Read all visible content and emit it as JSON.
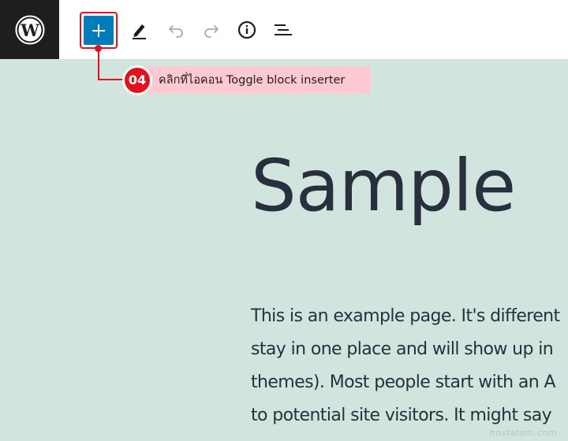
{
  "toolbar": {
    "logo": "wordpress-logo",
    "inserter_icon": "plus-icon",
    "tools": [
      "pen-icon",
      "undo-icon",
      "redo-icon",
      "info-icon",
      "list-view-icon"
    ]
  },
  "callout": {
    "step": "04",
    "text": "คลิกที่ไอคอน Toggle block inserter"
  },
  "page": {
    "title": "Sample",
    "body_lines": [
      "This is an example page. It's different",
      "stay in one place and will show up in",
      "themes). Most people start with an A",
      "to potential site visitors. It might say"
    ]
  },
  "watermark": "hostatom.com",
  "colors": {
    "background": "#d1e4dd",
    "accent": "#007cba",
    "highlight": "#e5101c",
    "label_bg": "#ffc9d2"
  }
}
